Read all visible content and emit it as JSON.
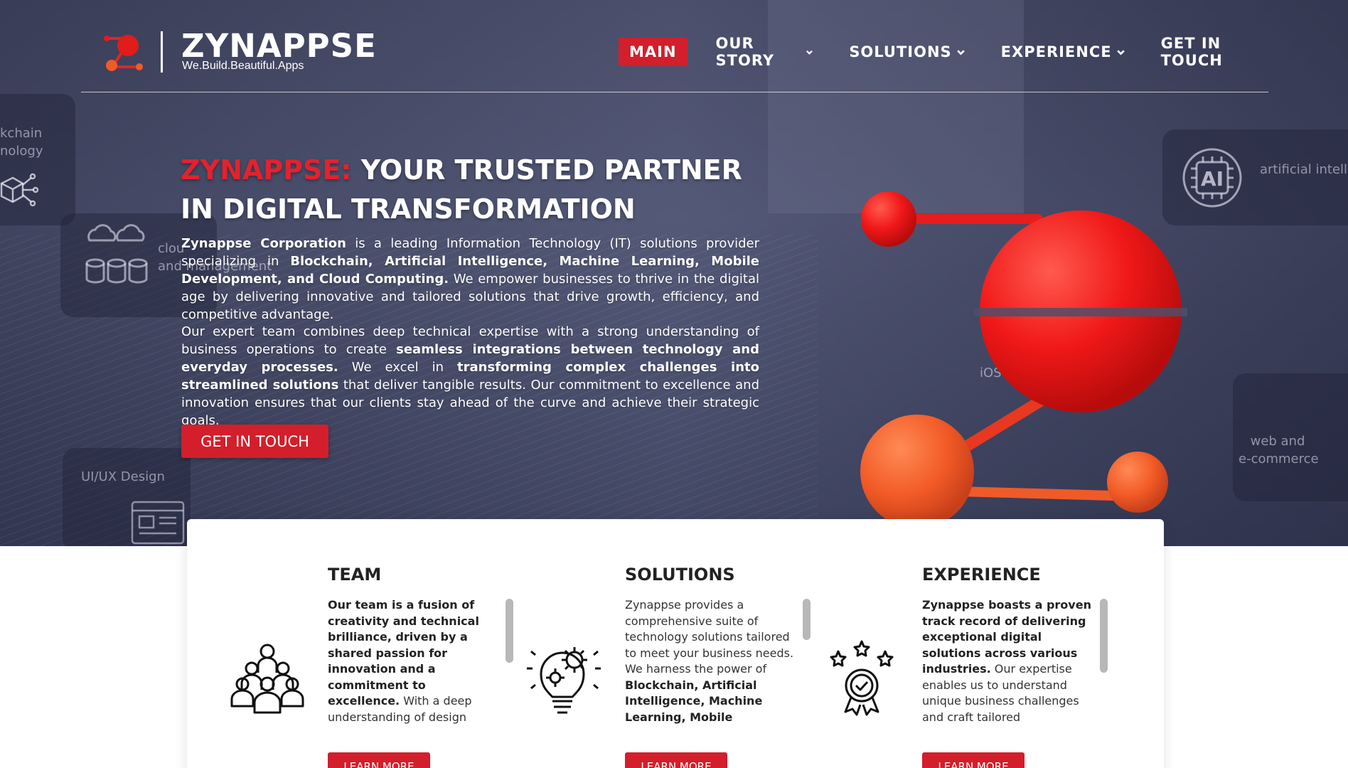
{
  "colors": {
    "accent": "#d21f2b",
    "hero_overlay": "#4a4e6a"
  },
  "brand": {
    "name": "ZYNAPPSE",
    "tagline": "We.Build.Beautiful.Apps",
    "logo_icon": "zynappse-logo-icon"
  },
  "nav": {
    "items": [
      {
        "label": "MAIN",
        "active": true,
        "dropdown": false
      },
      {
        "label": "OUR STORY",
        "dropdown": true
      },
      {
        "label": "SOLUTIONS",
        "dropdown": true
      },
      {
        "label": "EXPERIENCE",
        "dropdown": true
      },
      {
        "label": "GET IN TOUCH",
        "dropdown": false
      }
    ]
  },
  "background_labels": {
    "blockchain": "kchain\nnology",
    "cloud": "clou\nand management",
    "ai": "artificial intellige",
    "ios": "iOS",
    "web": "web and\ne-commerce",
    "uiux": "UI/UX Design"
  },
  "hero": {
    "title_brand": "ZYNAPPSE:",
    "title_rest": " YOUR TRUSTED PARTNER IN DIGITAL TRANSFORMATION",
    "p1_company": "Zynappse Corporation",
    "p1_a": " is a leading Information Technology (IT) solutions provider specializing in ",
    "p1_focus": "Blockchain, Artificial Intelligence, Machine Learning, Mobile Development, and Cloud Computing.",
    "p1_b": " We empower businesses to thrive in the digital age by delivering innovative and tailored solutions that drive growth, efficiency, and competitive advantage.",
    "p2_a": "Our expert team combines deep technical expertise with a strong understanding of business operations to create ",
    "p2_bold1": "seamless integrations between technology and everyday processes.",
    "p2_b": " We excel in ",
    "p2_bold2": "transforming complex challenges into streamlined solutions",
    "p2_c": " that deliver tangible results. Our commitment to excellence and innovation ensures that our clients stay ahead of the curve and achieve their strategic goals.",
    "cta": "GET IN TOUCH"
  },
  "sections": [
    {
      "title": "TEAM",
      "icon": "team-icon",
      "bold": "Our team is a fusion of creativity and technical brilliance, driven by a shared passion for innovation and a commitment to excellence.",
      "text": " With a deep understanding of design thinking and cutting-edge technologies, we",
      "button": "LEARN MORE"
    },
    {
      "title": "SOLUTIONS",
      "icon": "lightbulb-gear-icon",
      "text_a": "Zynappse provides a comprehensive suite of technology solutions tailored to meet your business needs. We harness the power of ",
      "bold": "Blockchain, Artificial Intelligence, Machine Learning, Mobile",
      "button": "LEARN MORE"
    },
    {
      "title": "EXPERIENCE",
      "icon": "award-badge-icon",
      "bold": "Zynappse boasts a proven track record of delivering exceptional digital solutions across various industries.",
      "text": " Our expertise enables us to understand unique business challenges and craft tailored applications. From concept to",
      "button": "LEARN MORE"
    }
  ]
}
